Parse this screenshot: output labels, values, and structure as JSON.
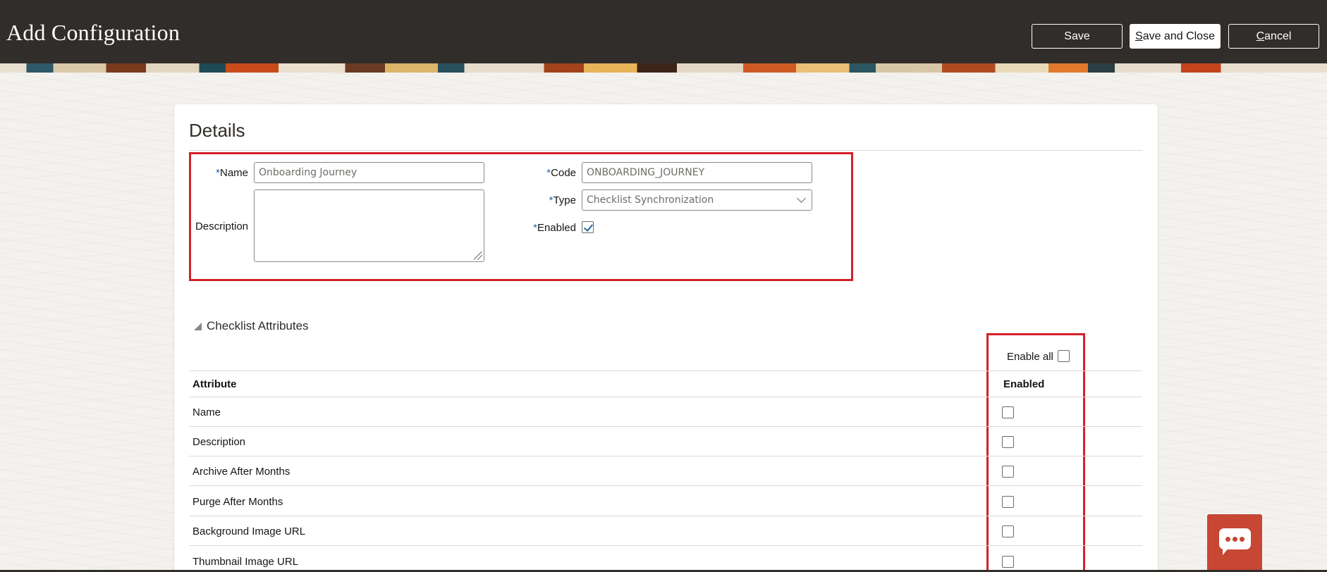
{
  "header": {
    "title": "Add Configuration",
    "save_label": "Save",
    "save_close_first": "S",
    "save_close_rest": "ave and Close",
    "cancel_first": "C",
    "cancel_rest": "ancel"
  },
  "details": {
    "section_title": "Details",
    "required_mark": "*",
    "name_label": "Name",
    "name_value": "Onboarding Journey",
    "description_label": "Description",
    "description_value": "",
    "code_label": "Code",
    "code_value": "ONBOARDING_JOURNEY",
    "type_label": "Type",
    "type_value": "Checklist Synchronization",
    "enabled_label": "Enabled",
    "enabled_checked": true
  },
  "attributes": {
    "section_title": "Checklist Attributes",
    "enable_all_label": "Enable all",
    "columns": [
      "Attribute",
      "Enabled"
    ],
    "rows": [
      {
        "name": "Name",
        "enabled": false
      },
      {
        "name": "Description",
        "enabled": false
      },
      {
        "name": "Archive After Months",
        "enabled": false
      },
      {
        "name": "Purge After Months",
        "enabled": false
      },
      {
        "name": "Background Image URL",
        "enabled": false
      },
      {
        "name": "Thumbnail Image URL",
        "enabled": false
      }
    ]
  },
  "colors": {
    "header_bg": "#312d2a",
    "highlight": "#d3202b",
    "accent_blue": "#1e65a3",
    "chat_button": "#c74634"
  },
  "icons": {
    "chat": "chat-bubble-icon",
    "disclosure": "triangle-down-icon",
    "select": "chevron-down-icon",
    "check": "checkmark-icon"
  }
}
